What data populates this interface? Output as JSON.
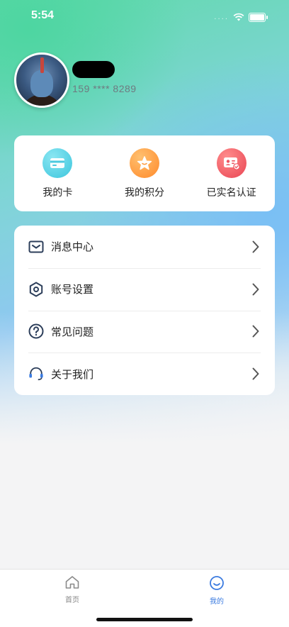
{
  "status_bar": {
    "time": "5:54",
    "signal_dots": "....",
    "wifi_icon": "wifi-icon",
    "battery_icon": "battery-icon"
  },
  "profile": {
    "avatar_icon": "avatar-image",
    "phone": "159 **** 8289"
  },
  "quick_actions": [
    {
      "label": "我的卡",
      "icon": "card-icon",
      "color": "#48d2e6"
    },
    {
      "label": "我的积分",
      "icon": "star-icon",
      "color": "#ff9a3c"
    },
    {
      "label": "已实名认证",
      "icon": "id-verified-icon",
      "color": "#f05a64"
    }
  ],
  "menu": [
    {
      "label": "消息中心",
      "icon": "message-icon"
    },
    {
      "label": "账号设置",
      "icon": "settings-icon"
    },
    {
      "label": "常见问题",
      "icon": "question-icon"
    },
    {
      "label": "关于我们",
      "icon": "headset-icon"
    }
  ],
  "tabs": [
    {
      "label": "首页",
      "icon": "home-icon",
      "active": false
    },
    {
      "label": "我的",
      "icon": "smile-icon",
      "active": true
    }
  ],
  "colors": {
    "accent": "#3b7be0",
    "tab_inactive": "#888888",
    "menu_icon": "#2c3e5a"
  }
}
